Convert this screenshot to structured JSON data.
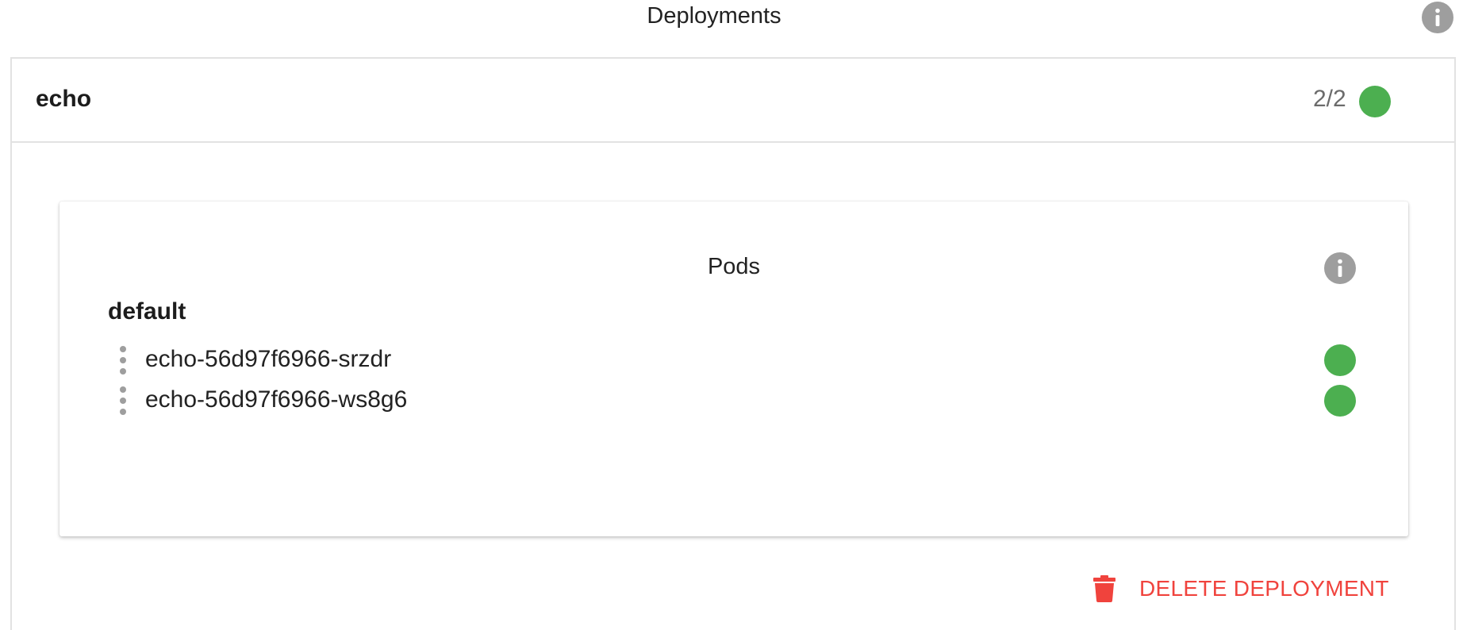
{
  "header": {
    "title": "Deployments",
    "info_icon": "info-icon"
  },
  "deployment": {
    "name": "echo",
    "replicas": "2/2",
    "status": "running",
    "status_color": "#4caf50"
  },
  "pods_card": {
    "title": "Pods",
    "info_icon": "info-icon",
    "namespace": "default",
    "pods": [
      {
        "name": "echo-56d97f6966-srzdr",
        "status": "running",
        "status_color": "#4caf50",
        "menu_icon": "more-vert-icon"
      },
      {
        "name": "echo-56d97f6966-ws8g6",
        "status": "running",
        "status_color": "#4caf50",
        "menu_icon": "more-vert-icon"
      }
    ]
  },
  "actions": {
    "delete_label": "DELETE DEPLOYMENT",
    "delete_icon": "trash-icon",
    "delete_color": "#f0433d"
  },
  "colors": {
    "status_green": "#4caf50",
    "icon_grey": "#9e9e9e",
    "danger_red": "#f0433d"
  }
}
